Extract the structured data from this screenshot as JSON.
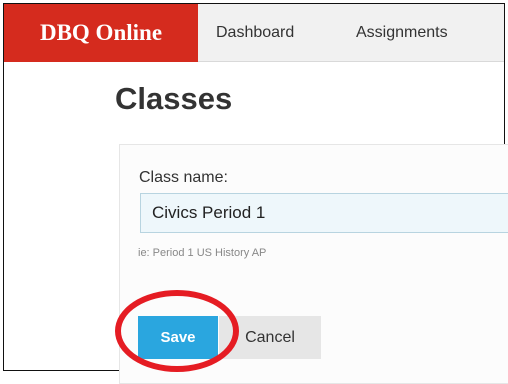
{
  "navbar": {
    "brand": "DBQ Online",
    "links": [
      "Dashboard",
      "Assignments"
    ],
    "brand_color": "#d52b1e"
  },
  "page": {
    "title": "Classes"
  },
  "form": {
    "class_name_label": "Class name:",
    "class_name_value": "Civics Period 1",
    "hint": "ie: Period 1 US History AP",
    "save_label": "Save",
    "cancel_label": "Cancel",
    "save_color": "#2aa6df"
  },
  "annotation": {
    "ring_color": "#e51c23"
  }
}
